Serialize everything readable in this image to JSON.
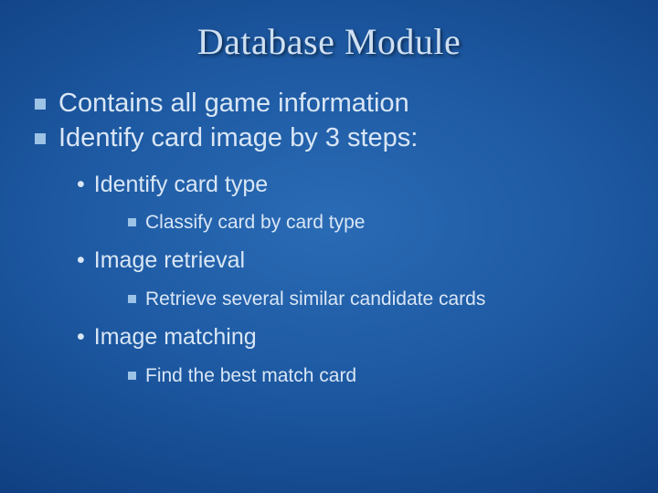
{
  "title": "Database Module",
  "bullets": [
    {
      "text": "Contains all game information"
    },
    {
      "text": "Identify card image by 3 steps:"
    }
  ],
  "sub": [
    {
      "text": "Identify card type",
      "child": "Classify card by card type"
    },
    {
      "text": "Image retrieval",
      "child": "Retrieve several similar candidate cards"
    },
    {
      "text": "Image matching",
      "child": "Find the best match card"
    }
  ]
}
